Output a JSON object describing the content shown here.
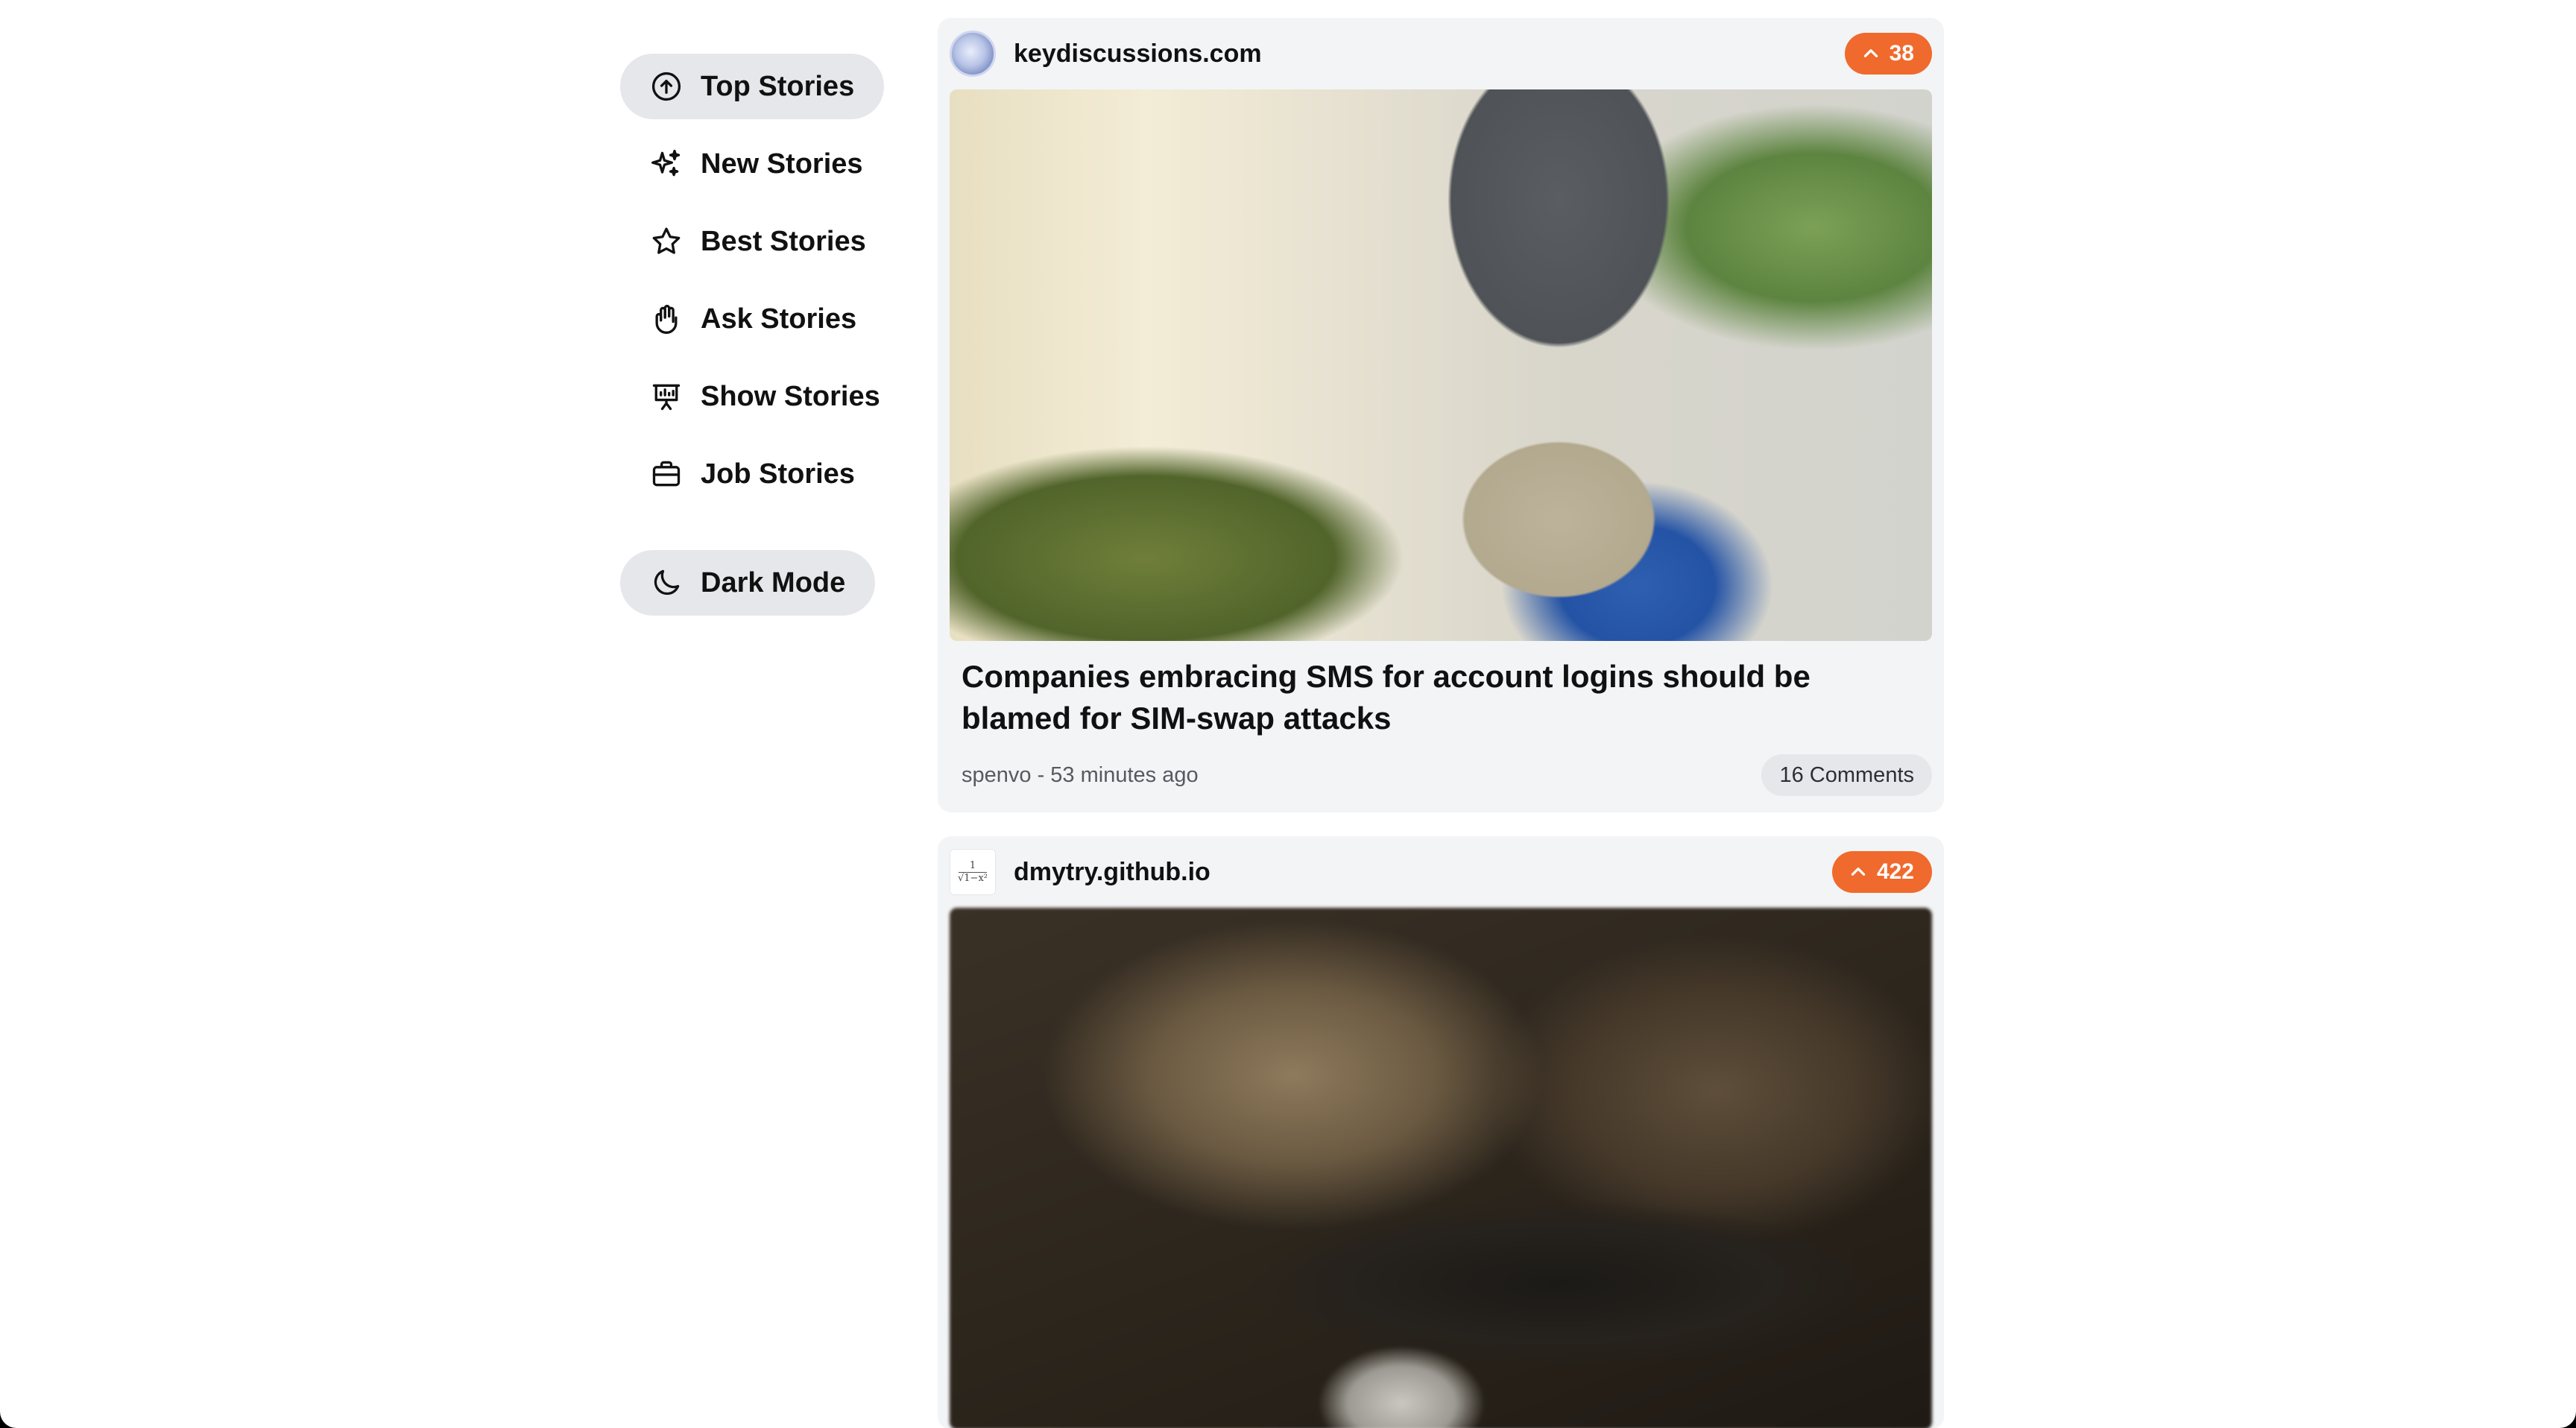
{
  "nav": {
    "items": [
      {
        "label": "Top Stories",
        "icon": "arrow-up-circle-icon"
      },
      {
        "label": "New Stories",
        "icon": "sparkles-icon"
      },
      {
        "label": "Best Stories",
        "icon": "star-icon"
      },
      {
        "label": "Ask Stories",
        "icon": "hand-icon"
      },
      {
        "label": "Show Stories",
        "icon": "presentation-icon"
      },
      {
        "label": "Job Stories",
        "icon": "briefcase-icon"
      }
    ],
    "active_index": 0,
    "dark_mode_label": "Dark Mode",
    "dark_mode_icon": "moon-icon"
  },
  "stories": [
    {
      "site": "keydiscussions.com",
      "favicon": "globe-icon",
      "score": "38",
      "title": "Companies embracing SMS for account logins should be blamed for SIM-swap attacks",
      "byline": "spenvo - 53 minutes ago",
      "comments": "16 Comments"
    },
    {
      "site": "dmytry.github.io",
      "favicon": "math-formula-icon",
      "score": "422"
    }
  ],
  "colors": {
    "accent": "#ef6a2c",
    "card_bg": "#f3f4f6",
    "pill_bg": "#e5e7eb",
    "text": "#111111"
  }
}
